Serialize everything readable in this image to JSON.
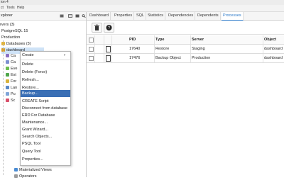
{
  "window": {
    "title": "ion 4"
  },
  "menubar": {
    "items": [
      "ct",
      "Tools",
      "Help"
    ]
  },
  "explorer": {
    "title": "xplorer",
    "tree": [
      {
        "label": "rvers (3)"
      },
      {
        "label": "PostgreSQL 15"
      },
      {
        "label": "Production"
      },
      {
        "label": "Databases (3)"
      },
      {
        "label": "dashboard"
      },
      {
        "label": "Ca"
      },
      {
        "label": "Ca"
      },
      {
        "label": "Eve"
      },
      {
        "label": "Ext"
      },
      {
        "label": "For"
      },
      {
        "label": "Lan"
      },
      {
        "label": "Pu"
      },
      {
        "label": "Sc"
      },
      {
        "label": "Materialized Views"
      },
      {
        "label": "Operators"
      }
    ]
  },
  "tabs": [
    "Dashboard",
    "Properties",
    "SQL",
    "Statistics",
    "Dependencies",
    "Dependents",
    "Processes"
  ],
  "active_tab": "Processes",
  "table": {
    "columns": [
      "PID",
      "Type",
      "Server",
      "Object"
    ],
    "rows": [
      {
        "pid": "17640",
        "type": "Restore",
        "server": "Staging",
        "object": "dashboard"
      },
      {
        "pid": "17476",
        "type": "Backup Object",
        "server": "Production",
        "object": "dashboard"
      }
    ]
  },
  "context_menu": {
    "items": [
      "Create",
      "Delete",
      "Delete (Force)",
      "Refresh...",
      "Restore...",
      "Backup...",
      "CREATE Script",
      "Disconnect from database",
      "ERD For Database",
      "Maintenance...",
      "Grant Wizard...",
      "Search Objects...",
      "PSQL Tool",
      "Query Tool",
      "Properties..."
    ],
    "highlighted": "Backup..."
  },
  "colors": {
    "accent": "#2a78c8",
    "menu_highlight": "#3a6fb5",
    "tree_selected": "#cfe3f7"
  }
}
